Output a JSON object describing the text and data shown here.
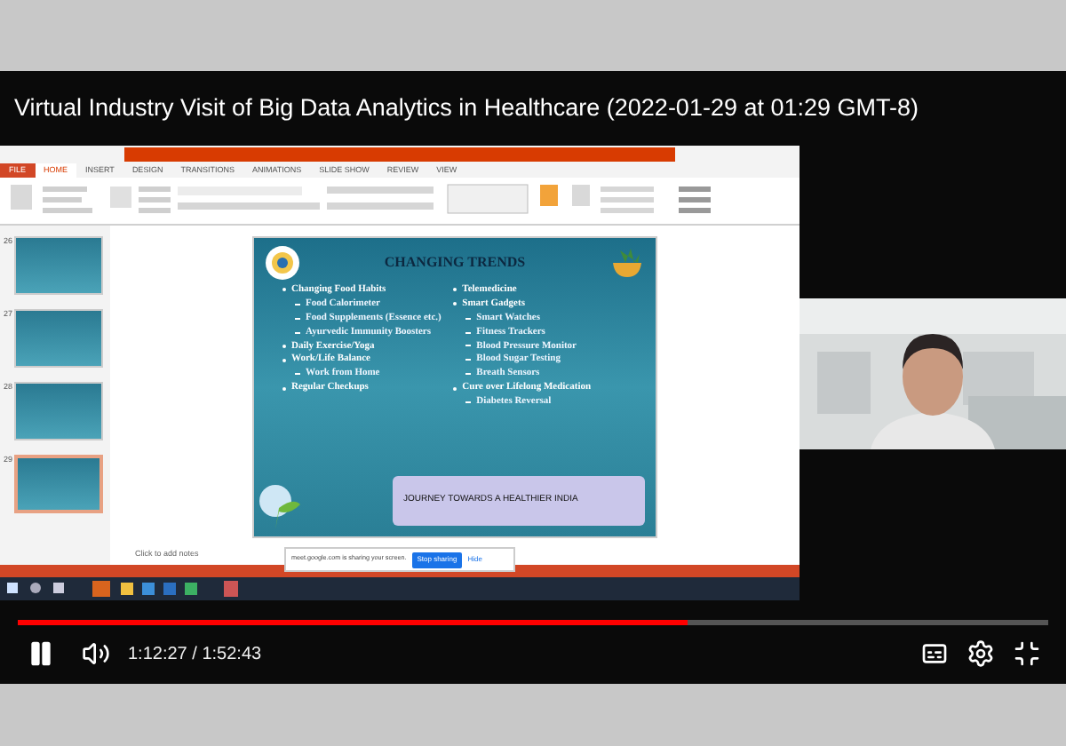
{
  "video_title": "Virtual Industry Visit of Big Data Analytics in Healthcare (2022-01-29 at 01:29 GMT-8)",
  "presentation": {
    "tabs": [
      {
        "label": "FILE",
        "selected": false
      },
      {
        "label": "HOME",
        "selected": true
      },
      {
        "label": "INSERT",
        "selected": false
      },
      {
        "label": "DESIGN",
        "selected": false
      },
      {
        "label": "TRANSITIONS",
        "selected": false
      },
      {
        "label": "ANIMATIONS",
        "selected": false
      },
      {
        "label": "SLIDE SHOW",
        "selected": false
      },
      {
        "label": "REVIEW",
        "selected": false
      },
      {
        "label": "VIEW",
        "selected": false
      }
    ],
    "thumbnails": [
      {
        "number": "26",
        "selected": false
      },
      {
        "number": "27",
        "selected": false
      },
      {
        "number": "28",
        "selected": false
      },
      {
        "number": "29",
        "selected": true
      }
    ],
    "slide": {
      "heading": "CHANGING TRENDS",
      "left_bullets": [
        {
          "text": "Changing Food Habits",
          "children": [
            {
              "text": "Food Calorimeter"
            },
            {
              "text": "Food Supplements (Essence etc.)"
            },
            {
              "text": "Ayurvedic Immunity Boosters"
            }
          ]
        },
        {
          "text": "Daily Exercise/Yoga"
        },
        {
          "text": "Work/Life Balance",
          "children": [
            {
              "text": "Work from Home"
            }
          ]
        },
        {
          "text": "Regular Checkups"
        }
      ],
      "right_bullets": [
        {
          "text": "Telemedicine"
        },
        {
          "text": "Smart Gadgets",
          "children": [
            {
              "text": "Smart Watches"
            },
            {
              "text": "Fitness Trackers"
            },
            {
              "text": "Blood Pressure Monitor"
            },
            {
              "text": "Blood Sugar Testing"
            },
            {
              "text": "Breath Sensors"
            }
          ]
        },
        {
          "text": "Cure over Lifelong Medication",
          "children": [
            {
              "text": "Diabetes Reversal"
            }
          ]
        }
      ],
      "banner": "JOURNEY TOWARDS A HEALTHIER INDIA"
    },
    "notes_placeholder": "Click to add notes"
  },
  "share_bar": {
    "message": "meet.google.com is sharing your screen.",
    "stop_button": "Stop sharing",
    "hide_button": "Hide"
  },
  "player": {
    "playing": true,
    "progress": {
      "level": 0.65
    },
    "time": "1:12:27 / 1:52:43"
  }
}
